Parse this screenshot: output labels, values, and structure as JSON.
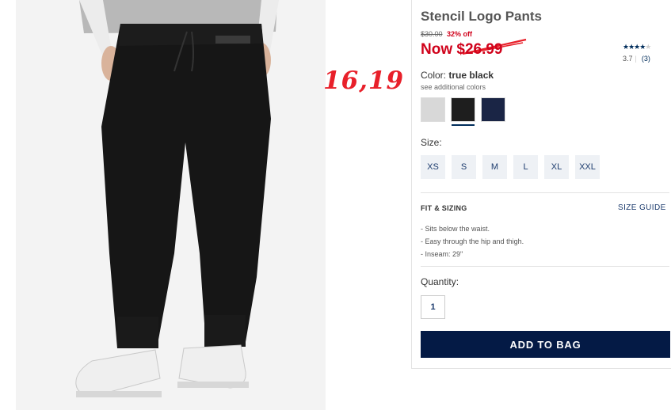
{
  "product": {
    "title": "Stencil Logo Pants",
    "original_price": "$30.00",
    "discount": "32% off",
    "now_price": "Now $26.99",
    "rating": {
      "stars_filled": 3.5,
      "stars_total": 5,
      "score": "3.7",
      "count": "(3)"
    }
  },
  "annotation": {
    "text": "16,19",
    "color": "#e8202a"
  },
  "color_section": {
    "label": "Color:",
    "selected": "true black",
    "see_more": "see additional colors",
    "swatches": [
      {
        "name": "heather-grey",
        "hex": "#d8d8d8",
        "selected": false
      },
      {
        "name": "true-black",
        "hex": "#1e1e1e",
        "selected": true
      },
      {
        "name": "navy",
        "hex": "#1a2545",
        "selected": false
      }
    ]
  },
  "size_section": {
    "label": "Size:",
    "options": [
      "XS",
      "S",
      "M",
      "L",
      "XL",
      "XXL"
    ]
  },
  "fit": {
    "heading": "FIT & SIZING",
    "guide_link": "SIZE GUIDE",
    "details": [
      "- Sits below the waist.",
      "- Easy through the hip and thigh.",
      "- Inseam: 29\""
    ]
  },
  "quantity": {
    "label": "Quantity:",
    "value": "1"
  },
  "cta": {
    "add_to_bag": "ADD TO BAG"
  },
  "colors": {
    "brand_navy": "#041a45",
    "sale_red": "#d0021b",
    "link_blue": "#1d3c6e"
  }
}
